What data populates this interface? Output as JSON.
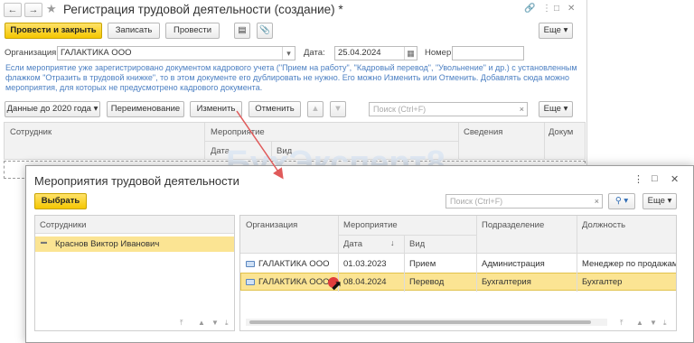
{
  "main": {
    "title": "Регистрация трудовой деятельности (создание) *",
    "toolbar": {
      "post_close": "Провести и закрыть",
      "save": "Записать",
      "post": "Провести",
      "more": "Еще"
    },
    "fields": {
      "org_label": "Организация:",
      "org_value": "ГАЛАКТИКА ООО",
      "date_label": "Дата:",
      "date_value": "25.04.2024",
      "number_label": "Номер:",
      "number_value": ""
    },
    "hint": "Если мероприятие уже зарегистрировано документом кадрового учета (\"Прием на работу\", \"Кадровый перевод\", \"Увольнение\" и др.) с установленным флажком \"Отразить в трудовой книжке\", то в этом документе его дублировать не нужно. Его можно Изменить или Отменить. Добавлять сюда можно мероприятия, для которых не предусмотрено кадрового документа.",
    "table_toolbar": {
      "data_before_2020": "Данные до 2020 года",
      "rename": "Переименование",
      "change": "Изменить",
      "cancel": "Отменить",
      "search_placeholder": "Поиск (Ctrl+F)",
      "more": "Еще"
    },
    "columns": {
      "employee": "Сотрудник",
      "event": "Мероприятие",
      "date": "Дата",
      "kind": "Вид",
      "info": "Сведения",
      "document": "Докум"
    },
    "watermark": "БухЭксперт8"
  },
  "dialog": {
    "title": "Мероприятия трудовой деятельности",
    "select": "Выбрать",
    "search_placeholder": "Поиск (Ctrl+F)",
    "more": "Еще",
    "employees_header": "Сотрудники",
    "employees": [
      "Краснов Виктор Иванович"
    ],
    "columns": {
      "org": "Организация",
      "event": "Мероприятие",
      "date": "Дата",
      "kind": "Вид",
      "department": "Подразделение",
      "position": "Должность"
    },
    "rows": [
      {
        "org": "ГАЛАКТИКА ООО",
        "date": "01.03.2023",
        "kind": "Прием",
        "department": "Администрация",
        "position": "Менеджер по продажам"
      },
      {
        "org": "ГАЛАКТИКА ООО",
        "date": "08.04.2024",
        "kind": "Перевод",
        "department": "Бухгалтерия",
        "position": "Бухгалтер"
      }
    ]
  },
  "colors": {
    "accent_yellow": "#f5c700",
    "selected_row": "#fbe493",
    "hint_text": "#4b7fc2",
    "arrow": "#e05a5a"
  }
}
